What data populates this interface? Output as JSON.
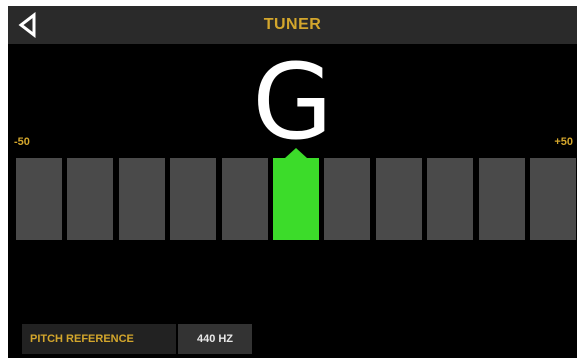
{
  "header": {
    "title": "TUNER",
    "back_icon": "back-triangle-icon"
  },
  "tuner": {
    "note": "G",
    "scale_min": "-50",
    "scale_max": "+50",
    "segment_count": 11,
    "active_segment": 5,
    "colors": {
      "active": "#3cdc2a",
      "inactive": "#4a4a4a",
      "accent": "#d3a62c"
    }
  },
  "pitch_reference": {
    "label": "PITCH REFERENCE",
    "value": "440 HZ"
  }
}
